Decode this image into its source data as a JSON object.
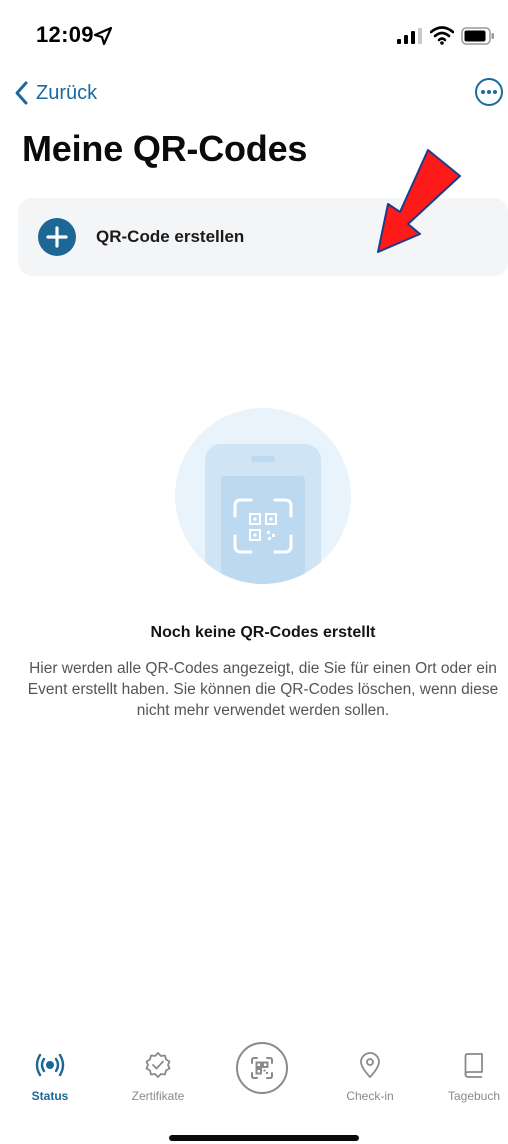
{
  "status_bar": {
    "time": "12:09"
  },
  "nav": {
    "back_label": "Zurück"
  },
  "page": {
    "title": "Meine QR-Codes"
  },
  "create_card": {
    "label": "QR-Code erstellen"
  },
  "empty_state": {
    "title": "Noch keine QR-Codes erstellt",
    "description": "Hier werden alle QR-Codes angezeigt, die Sie für einen Ort oder ein Event erstellt haben. Sie können die QR-Codes löschen, wenn diese nicht mehr verwendet werden sollen."
  },
  "tab_bar": {
    "tabs": [
      {
        "label": "Status",
        "icon": "broadcast-icon",
        "active": true
      },
      {
        "label": "Zertifikate",
        "icon": "certificate-check-icon",
        "active": false
      },
      {
        "label": "",
        "icon": "qr-scan-icon",
        "active": false
      },
      {
        "label": "Check-in",
        "icon": "location-pin-icon",
        "active": false
      },
      {
        "label": "Tagebuch",
        "icon": "book-icon",
        "active": false
      }
    ]
  },
  "colors": {
    "accent": "#1d6796",
    "link": "#1a6aa0",
    "card_bg": "#f4f5f7",
    "annotation_arrow": "#ff1a1a"
  }
}
